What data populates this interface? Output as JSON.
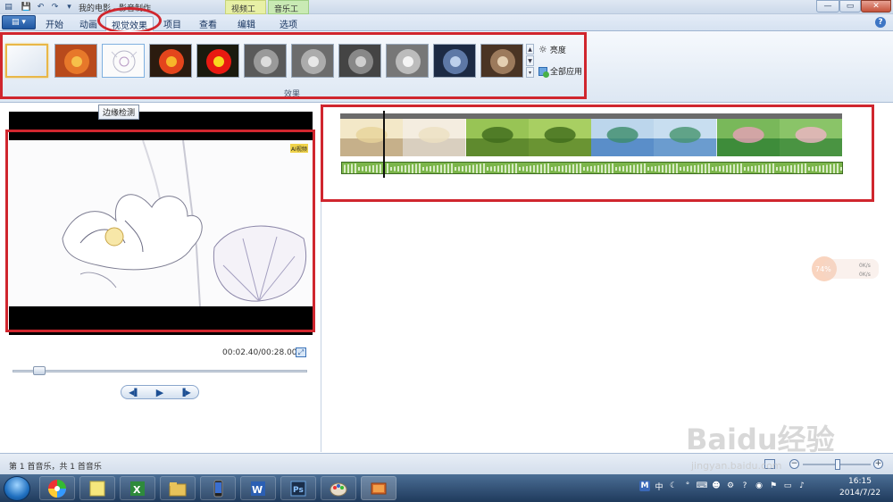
{
  "titlebar": {
    "title": "我的电影 - 影音制作",
    "context_tabs": {
      "video_tools": "视频工具",
      "music_tools": "音乐工具"
    }
  },
  "ribbon": {
    "tabs": [
      "开始",
      "动画",
      "视觉效果",
      "项目",
      "查看",
      "编辑",
      "选项"
    ],
    "active_tab": "视觉效果",
    "group_label": "效果",
    "brightness_label": "亮度",
    "apply_all_label": "全部应用",
    "effects": [
      {
        "name": "none",
        "preview": "plain"
      },
      {
        "name": "warm",
        "preview": "orange"
      },
      {
        "name": "edge",
        "preview": "sketch"
      },
      {
        "name": "orange-flower",
        "preview": "orange-red"
      },
      {
        "name": "red-flower",
        "preview": "red-yellow"
      },
      {
        "name": "grayscale-1",
        "preview": "gray"
      },
      {
        "name": "grayscale-2",
        "preview": "gray"
      },
      {
        "name": "grayscale-3",
        "preview": "gray"
      },
      {
        "name": "grayscale-4",
        "preview": "gray"
      },
      {
        "name": "cyanotype",
        "preview": "blue"
      },
      {
        "name": "sepia",
        "preview": "sepia"
      }
    ]
  },
  "tooltip": {
    "text": "边缘检测"
  },
  "preview": {
    "time": "00:02.40/00:28.00",
    "seek_progress": 0.086,
    "logo_text": "AI视频"
  },
  "storyboard": {
    "clips": [
      {
        "kind": "lotus-warm"
      },
      {
        "kind": "lotus-fade"
      },
      {
        "kind": "rice-green"
      },
      {
        "kind": "rice-green-2"
      },
      {
        "kind": "lake-blue"
      },
      {
        "kind": "lake-blue-2"
      },
      {
        "kind": "lotus-leaves"
      },
      {
        "kind": "lotus-leaves-2"
      }
    ]
  },
  "statusbar": {
    "text": "第 1 首音乐，共 1 首音乐"
  },
  "speed_widget": {
    "percent": "74%",
    "up": "0K/s",
    "down": "0K/s"
  },
  "taskbar": {
    "apps": [
      "picasa",
      "sticky-notes",
      "excel",
      "explorer",
      "phone",
      "word",
      "photoshop",
      "paint",
      "movie-maker"
    ],
    "clock_time": "16:15",
    "clock_date": "2014/7/22",
    "ime_label": "M",
    "lang_label": "中"
  },
  "watermark": {
    "brand": "Baidu经验",
    "url": "jingyan.baidu.com"
  },
  "colors": {
    "annotation_red": "#d0262e",
    "ribbon_blue": "#dde7f3",
    "audio_green": "#7bb54a"
  }
}
